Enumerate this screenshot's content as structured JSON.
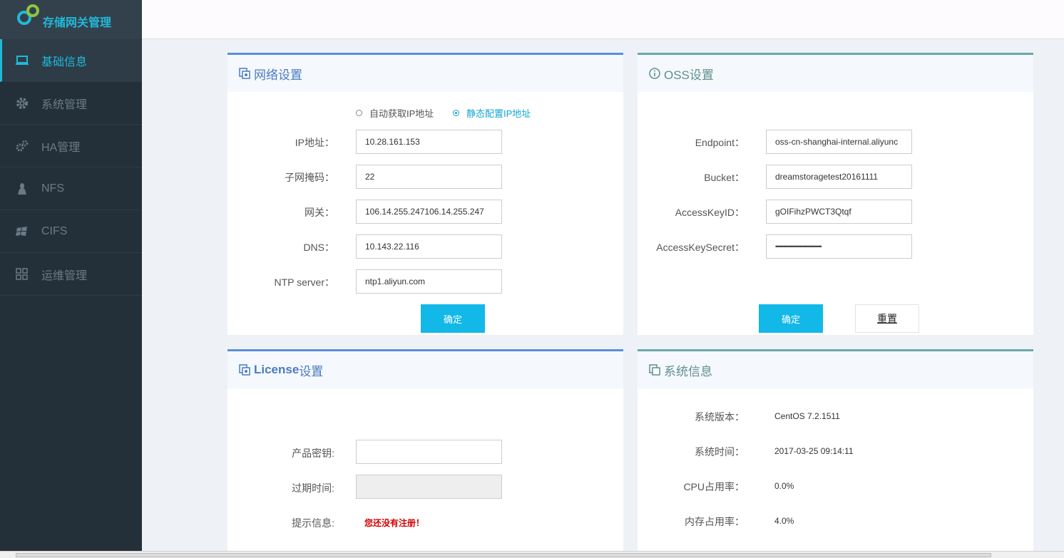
{
  "app": {
    "title": "存储网关管理"
  },
  "sidebar": {
    "items": [
      {
        "label": "基础信息",
        "icon": "laptop-icon",
        "active": true
      },
      {
        "label": "系统管理",
        "icon": "gear-icon",
        "active": false
      },
      {
        "label": "HA管理",
        "icon": "gears-icon",
        "active": false
      },
      {
        "label": "NFS",
        "icon": "linux-icon",
        "active": false
      },
      {
        "label": "CIFS",
        "icon": "windows-icon",
        "active": false
      },
      {
        "label": "运维管理",
        "icon": "grid-icon",
        "active": false
      }
    ]
  },
  "network": {
    "title": "网络设置",
    "radio_auto": "自动获取IP地址",
    "radio_static": "静态配置IP地址",
    "selected": "static",
    "ip_label": "IP地址：",
    "ip_value": "10.28.161.153",
    "mask_label": "子网掩码：",
    "mask_value": "22",
    "gateway_label": "网关：",
    "gateway_value": "106.14.255.247106.14.255.247",
    "dns_label": "DNS：",
    "dns_value": "10.143.22.116",
    "ntp_label": "NTP server：",
    "ntp_value": "ntp1.aliyun.com",
    "confirm_label": "确定"
  },
  "oss": {
    "title": "OSS设置",
    "endpoint_label": "Endpoint：",
    "endpoint_value": "oss-cn-shanghai-internal.aliyunc",
    "bucket_label": "Bucket：",
    "bucket_value": "dreamstoragetest20161111",
    "keyid_label": "AccessKeyID：",
    "keyid_value": "gOIFihzPWCT3Qtqf",
    "secret_label": "AccessKeySecret：",
    "secret_value": "••••••••••••••••••••••••••••••",
    "confirm_label": "确定",
    "reset_label": "重置"
  },
  "license": {
    "title_en": "License",
    "title_zh": "设置",
    "key_label": "产品密钥:",
    "key_value": "",
    "expire_label": "过期时间:",
    "expire_value": "",
    "hint_label": "提示信息:",
    "hint_value": "您还没有注册！"
  },
  "sysinfo": {
    "title": "系统信息",
    "version_label": "系统版本：",
    "version_value": "CentOS 7.2.1511",
    "time_label": "系统时间：",
    "time_value": "2017-03-25 09:14:11",
    "cpu_label": "CPU占用率：",
    "cpu_value": "0.0%",
    "mem_label": "内存占用率：",
    "mem_value": "4.0%"
  },
  "colors": {
    "accent": "#21b9d8",
    "primary_button": "#12b8e8",
    "sidebar_bg": "#243039",
    "warning": "#d40000"
  }
}
